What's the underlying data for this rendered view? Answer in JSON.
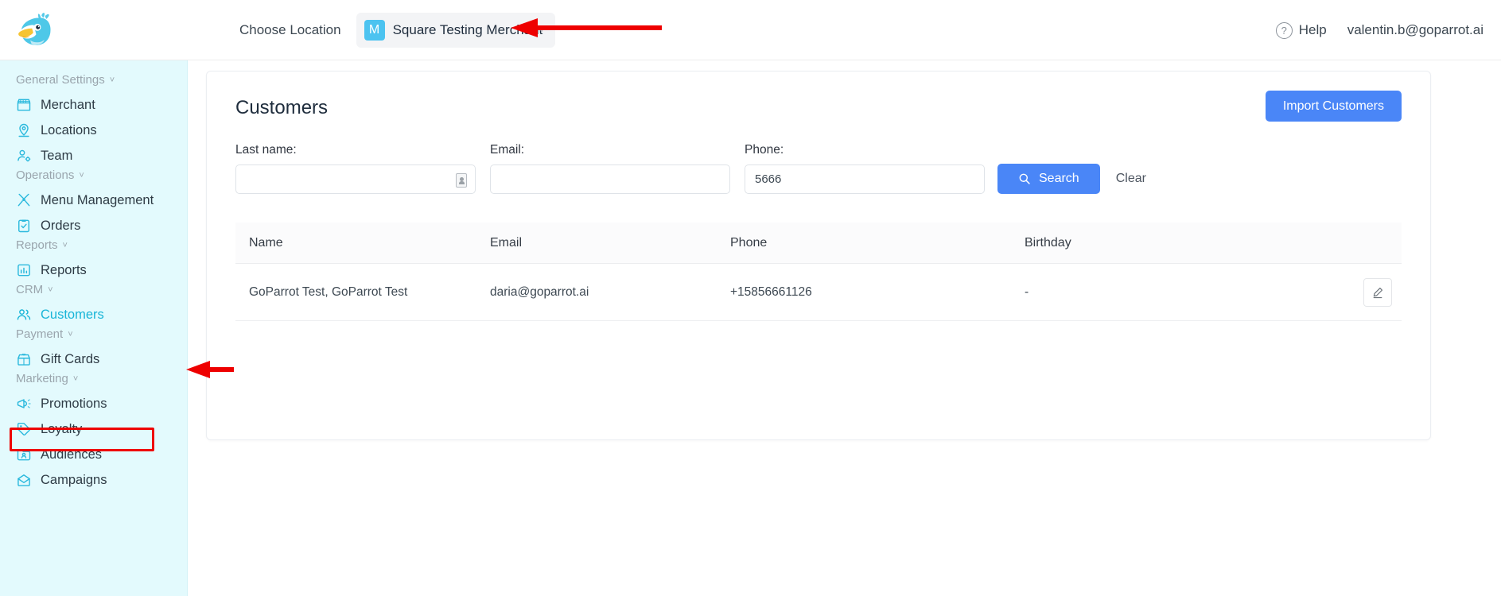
{
  "topbar": {
    "logo_name": "goparrot-parrot-logo",
    "choose_location_label": "Choose Location",
    "merchant": {
      "avatar_initial": "M",
      "name": "Square Testing Merchant",
      "caret": "˅"
    },
    "help_label": "Help",
    "help_icon_glyph": "?",
    "user_email": "valentin.b@goparrot.ai"
  },
  "sidebar": {
    "groups": [
      {
        "title": "General Settings",
        "caret": "˅",
        "items": [
          {
            "label": "Merchant",
            "icon": "storefront-icon",
            "active": false
          },
          {
            "label": "Locations",
            "icon": "map-pin-icon",
            "active": false
          },
          {
            "label": "Team",
            "icon": "user-gear-icon",
            "active": false
          }
        ]
      },
      {
        "title": "Operations",
        "caret": "˅",
        "items": [
          {
            "label": "Menu Management",
            "icon": "fork-knife-icon",
            "active": false
          },
          {
            "label": "Orders",
            "icon": "clipboard-check-icon",
            "active": false
          }
        ]
      },
      {
        "title": "Reports",
        "caret": "˅",
        "items": [
          {
            "label": "Reports",
            "icon": "bar-chart-icon",
            "active": false
          }
        ]
      },
      {
        "title": "CRM",
        "caret": "˅",
        "items": [
          {
            "label": "Customers",
            "icon": "people-icon",
            "active": true
          }
        ]
      },
      {
        "title": "Payment",
        "caret": "˅",
        "items": [
          {
            "label": "Gift Cards",
            "icon": "gift-card-icon",
            "active": false
          }
        ]
      },
      {
        "title": "Marketing",
        "caret": "˅",
        "items": [
          {
            "label": "Promotions",
            "icon": "megaphone-icon",
            "active": false
          },
          {
            "label": "Loyalty",
            "icon": "tag-icon",
            "active": false
          },
          {
            "label": "Audiences",
            "icon": "folder-user-icon",
            "active": false
          },
          {
            "label": "Campaigns",
            "icon": "mail-open-icon",
            "active": false
          }
        ]
      }
    ]
  },
  "main": {
    "page_title": "Customers",
    "import_button_label": "Import Customers",
    "filters": {
      "last_name": {
        "label": "Last name:",
        "value": "",
        "placeholder": ""
      },
      "email": {
        "label": "Email:",
        "value": "",
        "placeholder": ""
      },
      "phone": {
        "label": "Phone:",
        "value": "5666",
        "placeholder": ""
      },
      "search_button_label": "Search",
      "search_icon": "magnifier-icon",
      "clear_button_label": "Clear"
    },
    "table": {
      "columns": [
        "Name",
        "Email",
        "Phone",
        "Birthday"
      ],
      "rows": [
        {
          "name": "GoParrot Test, GoParrot Test",
          "email": "daria@goparrot.ai",
          "phone": "+15856661126",
          "birthday": "-",
          "action_icon": "pencil-edit-icon"
        }
      ]
    }
  },
  "annotations": {
    "accent_color": "#ee0000",
    "arrow_to_merchant": "points-left-at-merchant-selector",
    "arrow_to_customers": "points-left-at-customers-nav-item",
    "highlight_box": "customers-nav-item"
  },
  "colors": {
    "sidebar_bg": "#e3fafd",
    "primary_blue": "#4a86f7",
    "icon_teal": "#2bb9dd",
    "active_nav": "#19b5d8",
    "annotation_red": "#ee0000"
  }
}
